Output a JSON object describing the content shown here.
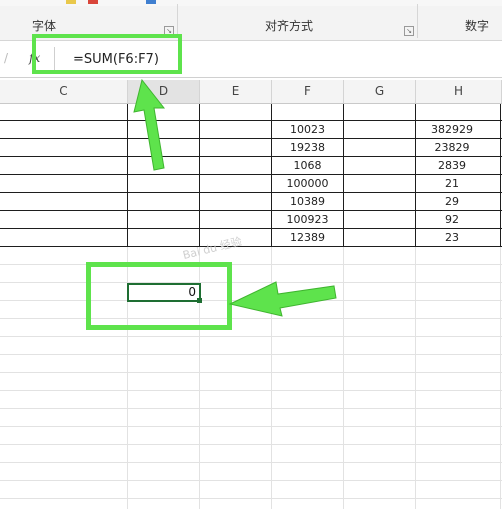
{
  "ribbon": {
    "groups": [
      {
        "label": "字体"
      },
      {
        "label": "对齐方式"
      },
      {
        "label": "数字"
      }
    ]
  },
  "formula_bar": {
    "fx_label": "fx",
    "formula": "=SUM(F6:F7)"
  },
  "columns": [
    "C",
    "D",
    "E",
    "F",
    "G",
    "H"
  ],
  "rows": [
    {
      "F": "10023",
      "H": "382929"
    },
    {
      "F": "19238",
      "H": "23829"
    },
    {
      "F": "1068",
      "H": "2839"
    },
    {
      "F": "100000",
      "H": "21"
    },
    {
      "F": "10389",
      "H": "29"
    },
    {
      "F": "100923",
      "H": "92"
    },
    {
      "F": "12389",
      "H": "23"
    }
  ],
  "selected_cell": {
    "value": "0"
  },
  "colors": {
    "highlight_green": "#5ee34c",
    "selection_border": "#1e6e32"
  },
  "watermark": {
    "text": "Bai du 经验"
  }
}
